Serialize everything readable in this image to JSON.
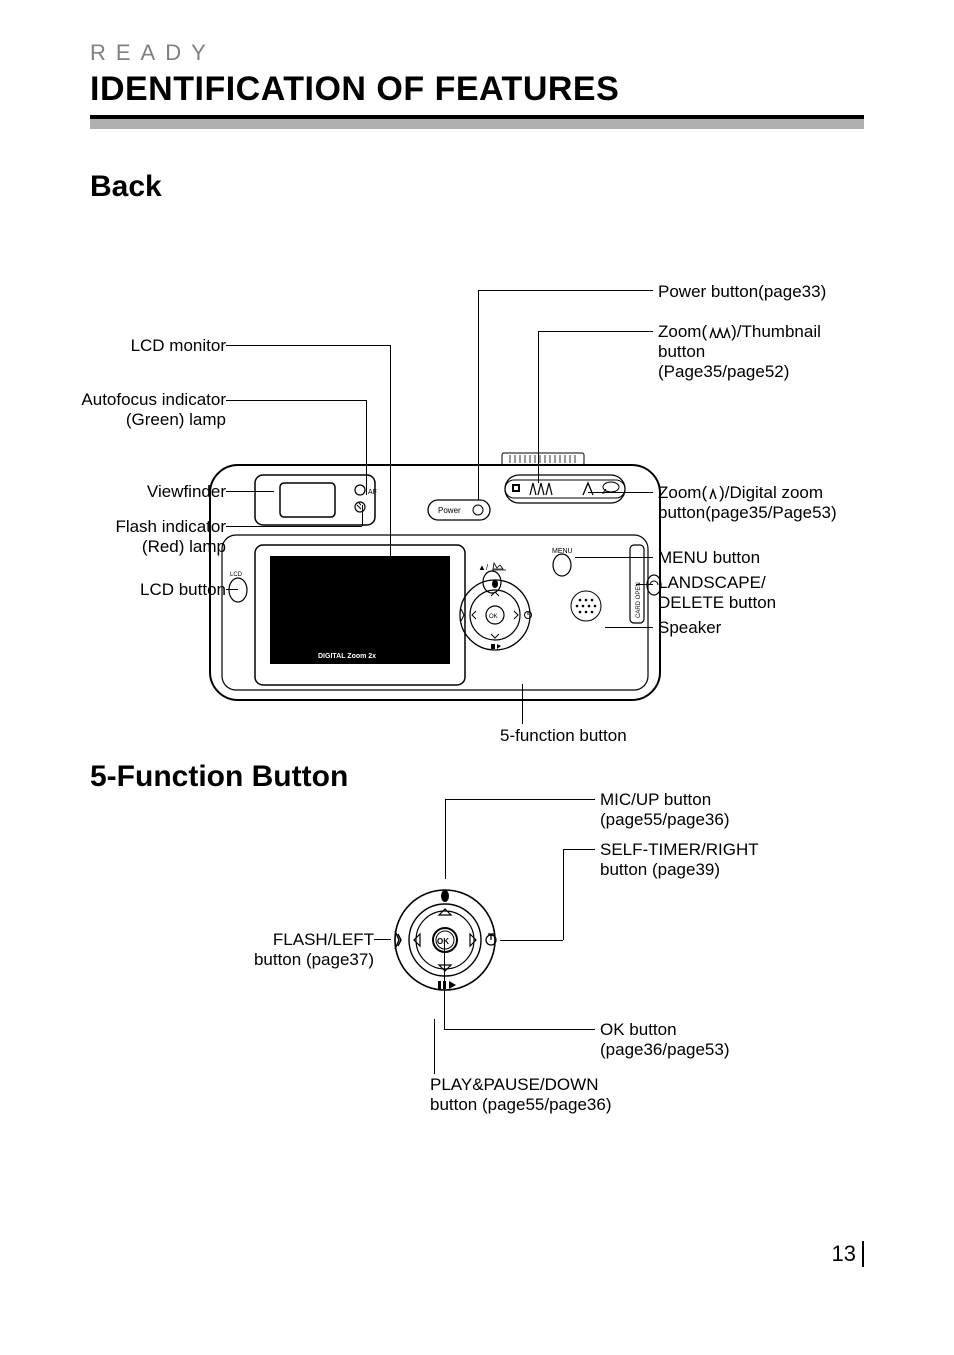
{
  "section": "READY",
  "title": "IDENTIFICATION OF FEATURES",
  "subheads": {
    "back": "Back",
    "fivefn": "5-Function Button"
  },
  "labels": {
    "left": {
      "lcd_monitor": "LCD monitor",
      "af_indicator_l1": "Autofocus indicator",
      "af_indicator_l2": "(Green) lamp",
      "viewfinder": "Viewfinder",
      "flash_ind_l1": "Flash indicator",
      "flash_ind_l2": "(Red) lamp",
      "lcd_button": "LCD button"
    },
    "right": {
      "power": "Power button(page33)",
      "zoom_thumb_l1": "Zoom(      )/Thumbnail",
      "zoom_thumb_l2": "button",
      "zoom_thumb_l3": "(Page35/page52)",
      "zoom_digital_l1": "Zoom(    )/Digital zoom",
      "zoom_digital_l2": "button(page35/Page53)",
      "menu": "MENU button",
      "landscape_l1": "LANDSCAPE/",
      "landscape_l2": "DELETE button",
      "speaker": "Speaker"
    },
    "bottom": {
      "five_fn": "5-function button"
    },
    "five": {
      "flash_left_l1": "FLASH/LEFT",
      "flash_left_l2": "button (page37)",
      "mic_up_l1": "MIC/UP button",
      "mic_up_l2": "(page55/page36)",
      "self_l1": "SELF-TIMER/RIGHT",
      "self_l2": "button (page39)",
      "ok_l1": "OK button",
      "ok_l2": "(page36/page53)",
      "play_l1": "PLAY&PAUSE/DOWN",
      "play_l2": "button (page55/page36)"
    }
  },
  "diagram_text": {
    "af": "AF",
    "power": "Power",
    "menu": "MENU",
    "lcd": "LCD",
    "card_open": "CARD OPEN",
    "digital_zoom": "DIGITAL Zoom 2x",
    "ok": "OK"
  },
  "page_number": "13"
}
